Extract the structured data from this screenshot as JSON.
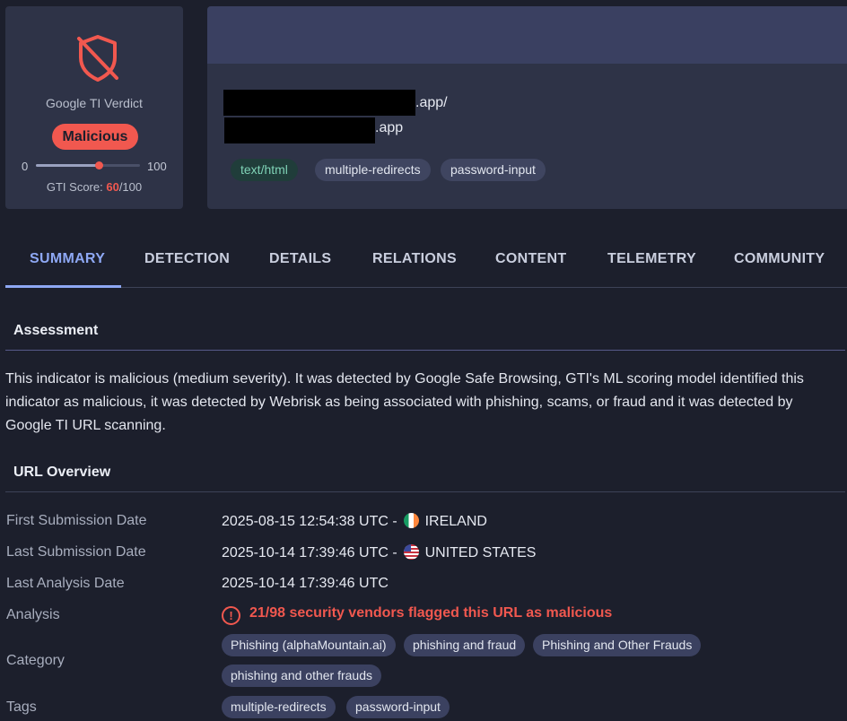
{
  "verdict": {
    "title": "Google TI Verdict",
    "badge": "Malicious",
    "score_min": "0",
    "score_max": "100",
    "score_prefix": "GTI Score: ",
    "score_value": "60",
    "score_suffix": "/100",
    "score_fraction": 0.6,
    "icon": "shield-off-icon",
    "accent_color": "#f1584f"
  },
  "url": {
    "line1_suffix": ".app/",
    "line2_suffix": ".app",
    "tags": [
      "text/html",
      "multiple-redirects",
      "password-input"
    ]
  },
  "tabs": [
    "SUMMARY",
    "DETECTION",
    "DETAILS",
    "RELATIONS",
    "CONTENT",
    "TELEMETRY",
    "COMMUNITY"
  ],
  "assessment": {
    "title": "Assessment",
    "text": "This indicator is malicious (medium severity). It was detected by Google Safe Browsing, GTI's ML scoring model identified this indicator as malicious, it was detected by Webrisk as being associated with phishing, scams, or fraud and it was detected by Google TI URL scanning."
  },
  "overview": {
    "title": "URL Overview",
    "first_submission": {
      "label": "First Submission Date",
      "value": "2025-08-15 12:54:38 UTC - ",
      "country": "IRELAND"
    },
    "last_submission": {
      "label": "Last Submission Date",
      "value": "2025-10-14 17:39:46 UTC - ",
      "country": "UNITED STATES"
    },
    "last_analysis": {
      "label": "Last Analysis Date",
      "value": "2025-10-14 17:39:46 UTC"
    },
    "analysis": {
      "label": "Analysis",
      "icon_text": "!",
      "value": "21/98 security vendors flagged this URL as malicious"
    },
    "category": {
      "label": "Category",
      "chips": [
        "Phishing (alphaMountain.ai)",
        "phishing and fraud",
        "Phishing and Other Frauds",
        "phishing and other frauds"
      ]
    },
    "tags": {
      "label": "Tags",
      "chips": [
        "multiple-redirects",
        "password-input"
      ]
    }
  }
}
